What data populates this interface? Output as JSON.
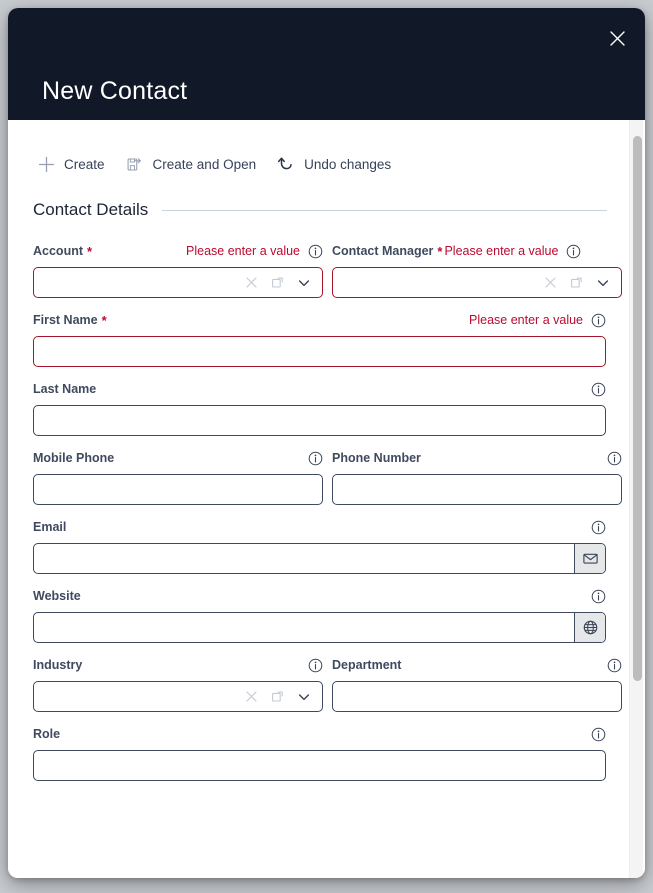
{
  "dialog": {
    "title": "New Contact",
    "close_icon": "close-icon"
  },
  "toolbar": {
    "items": [
      {
        "label": "Create",
        "icon": "plus-icon"
      },
      {
        "label": "Create and Open",
        "icon": "save-and-open-icon"
      },
      {
        "label": "Undo changes",
        "icon": "undo-icon"
      }
    ]
  },
  "section": {
    "title": "Contact Details"
  },
  "messages": {
    "please_enter_a_value": "Please enter a value"
  },
  "colors": {
    "header_bg": "#111827",
    "error_red": "#bb0a30",
    "label": "#3f4a5f",
    "border": "#3f4a5f",
    "error_border": "#a5162c",
    "button_bg": "#e6e7e9"
  },
  "fields": {
    "account": {
      "label": "Account",
      "required": true,
      "value": "",
      "error": "Please enter a value"
    },
    "contactManager": {
      "label": "Contact Manager",
      "required": true,
      "value": "",
      "error": "Please enter a value"
    },
    "firstName": {
      "label": "First Name",
      "required": true,
      "value": "",
      "error": "Please enter a value"
    },
    "lastName": {
      "label": "Last Name",
      "required": false,
      "value": "",
      "error": ""
    },
    "mobilePhone": {
      "label": "Mobile Phone",
      "required": false,
      "value": "",
      "error": ""
    },
    "phoneNumber": {
      "label": "Phone Number",
      "required": false,
      "value": "",
      "error": ""
    },
    "email": {
      "label": "Email",
      "required": false,
      "value": "",
      "error": ""
    },
    "website": {
      "label": "Website",
      "required": false,
      "value": "",
      "error": ""
    },
    "industry": {
      "label": "Industry",
      "required": false,
      "value": "",
      "error": ""
    },
    "department": {
      "label": "Department",
      "required": false,
      "value": "",
      "error": ""
    },
    "role": {
      "label": "Role",
      "required": false,
      "value": "",
      "error": ""
    }
  },
  "icons": {
    "info": "info-icon",
    "clear": "clear-icon",
    "open_in_new": "open-in-new-icon",
    "chevron_down": "chevron-down-icon",
    "email_action": "envelope-icon",
    "website_action": "globe-icon"
  }
}
